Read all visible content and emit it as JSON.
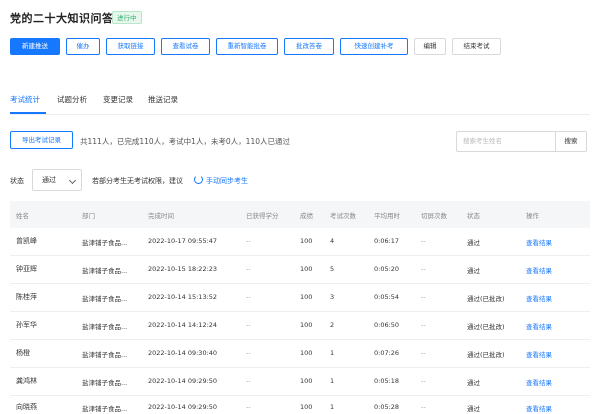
{
  "page": {
    "title": "党的二十大知识问答",
    "status_badge": "进行中"
  },
  "toolbar": {
    "buttons": [
      {
        "label": "新建推送"
      },
      {
        "label": "催办"
      },
      {
        "label": "获取链接"
      },
      {
        "label": "查看试卷"
      },
      {
        "label": "重新智能批卷"
      },
      {
        "label": "批改答卷"
      },
      {
        "label": "快速创建补考"
      },
      {
        "label": "编辑"
      },
      {
        "label": "结束考试"
      }
    ]
  },
  "tabs": [
    {
      "label": "考试统计",
      "active": true
    },
    {
      "label": "试题分析",
      "active": false
    },
    {
      "label": "变更记录",
      "active": false
    },
    {
      "label": "推送记录",
      "active": false
    }
  ],
  "stats": {
    "export_label": "导出考试记录",
    "summary": "共111人，已完成110人，考试中1人，未考0人，110人已通过"
  },
  "search": {
    "placeholder": "搜索考生姓名",
    "button_label": "搜索"
  },
  "filter": {
    "status_label": "状态",
    "status_value": "通过",
    "notice": "若部分考生无考试权限，建议",
    "sync_link": "手动同步考生"
  },
  "table": {
    "columns": [
      "姓名",
      "部门",
      "完成时间",
      "已获得学分",
      "成绩",
      "考试次数",
      "平均用时",
      "切屏次数",
      "状态",
      "操作"
    ],
    "rows": [
      {
        "name": "曾凯峰",
        "dept": "盐津铺子食品...",
        "time": "2022-10-17 09:55:47",
        "credit": "--",
        "score": "100",
        "attempts": "4",
        "avg": "0:06:17",
        "switch": "--",
        "status": "通过",
        "action": "查看结果"
      },
      {
        "name": "钟亚辉",
        "dept": "盐津铺子食品...",
        "time": "2022-10-15 18:22:23",
        "credit": "--",
        "score": "100",
        "attempts": "5",
        "avg": "0:05:20",
        "switch": "--",
        "status": "通过",
        "action": "查看结果"
      },
      {
        "name": "陈桂萍",
        "dept": "盐津铺子食品...",
        "time": "2022-10-14 15:13:52",
        "credit": "--",
        "score": "100",
        "attempts": "3",
        "avg": "0:05:54",
        "switch": "--",
        "status": "通过(已批改)",
        "action": "查看结果"
      },
      {
        "name": "孙军华",
        "dept": "盐津铺子食品...",
        "time": "2022-10-14 14:12:24",
        "credit": "--",
        "score": "100",
        "attempts": "2",
        "avg": "0:06:50",
        "switch": "--",
        "status": "通过(已批改)",
        "action": "查看结果"
      },
      {
        "name": "杨橙",
        "dept": "盐津铺子食品...",
        "time": "2022-10-14 09:30:40",
        "credit": "--",
        "score": "100",
        "attempts": "1",
        "avg": "0:07:26",
        "switch": "--",
        "status": "通过(已批改)",
        "action": "查看结果"
      },
      {
        "name": "龚鸿林",
        "dept": "盐津铺子食品...",
        "time": "2022-10-14 09:29:50",
        "credit": "--",
        "score": "100",
        "attempts": "1",
        "avg": "0:05:18",
        "switch": "--",
        "status": "通过",
        "action": "查看结果"
      },
      {
        "name": "向晓燕",
        "dept": "盐津铺子食品...",
        "time": "2022-10-14 09:29:50",
        "credit": "--",
        "score": "100",
        "attempts": "1",
        "avg": "0:05:28",
        "switch": "--",
        "status": "通过",
        "action": "查看结果"
      }
    ]
  }
}
